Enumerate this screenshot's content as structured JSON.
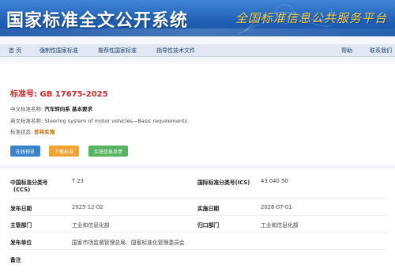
{
  "banner": {
    "title": "国家标准全文公开系统",
    "slogan": "全国标准信息公共服务平台"
  },
  "nav": {
    "home": "首 页",
    "mandatory": "强制性国家标准",
    "recommended": "推荐性国家标准",
    "guidance": "指导性技术文件",
    "help": "帮助",
    "contact": "联系我们"
  },
  "standard": {
    "number_label": "标准号:",
    "number": "GB 17675-2025",
    "cn_name_label": "中文标准名称:",
    "cn_name": "汽车转向系 基本要求",
    "en_name_label": "英文标准名称:",
    "en_name": "Steering system of motor vehicles—Basic requirements",
    "status_label": "标准状态:",
    "status": "即将实施"
  },
  "buttons": {
    "preview": "在线预览",
    "download": "下载标准",
    "feedback": "实施信息反馈"
  },
  "info": {
    "ccs_label": "中国标准分类号",
    "ccs_label2": "(CCS)",
    "ccs_value": "T 23",
    "ics_label": "国际标准分类号(ICS)",
    "ics_value": "43.040.50",
    "publish_label": "发布日期",
    "publish_value": "2025-12-02",
    "implement_label": "实施日期",
    "implement_value": "2026-07-01",
    "competent_label": "主管部门",
    "competent_value": "工业和信息化部",
    "owner_label": "归口部门",
    "owner_value": "工业和信息化部",
    "issuer_label": "发布单位",
    "issuer_value": "国家市场监督管理总局、国家标准化管理委员会",
    "remark_label": "备注"
  },
  "colors": {
    "banner": "#1f5fb5",
    "std_number": "#d1262b",
    "status": "#c27300",
    "btn_preview": "#3a82c9",
    "btn_download": "#f0a232",
    "btn_feedback": "#56b461"
  }
}
